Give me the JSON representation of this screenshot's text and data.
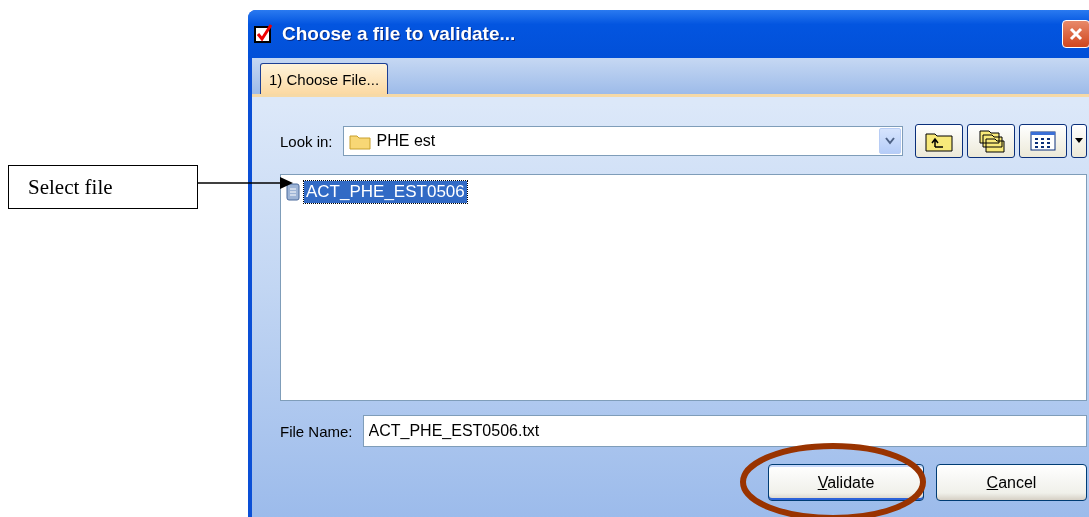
{
  "annotation": {
    "label": "Select file"
  },
  "window": {
    "title": "Choose a file to validate..."
  },
  "tabs": [
    {
      "label": "1) Choose File...",
      "selected": true
    }
  ],
  "look_in": {
    "label": "Look in:",
    "value": "PHE est"
  },
  "files": [
    {
      "name": "ACT_PHE_EST0506",
      "selected": true
    }
  ],
  "file_name": {
    "label": "File Name:",
    "value": "ACT_PHE_EST0506.txt"
  },
  "buttons": [
    {
      "mnemonic": "V",
      "label_rest": "alidate",
      "default": true,
      "circled": true
    },
    {
      "mnemonic": "C",
      "label_rest": "ancel",
      "default": false,
      "circled": false
    }
  ]
}
